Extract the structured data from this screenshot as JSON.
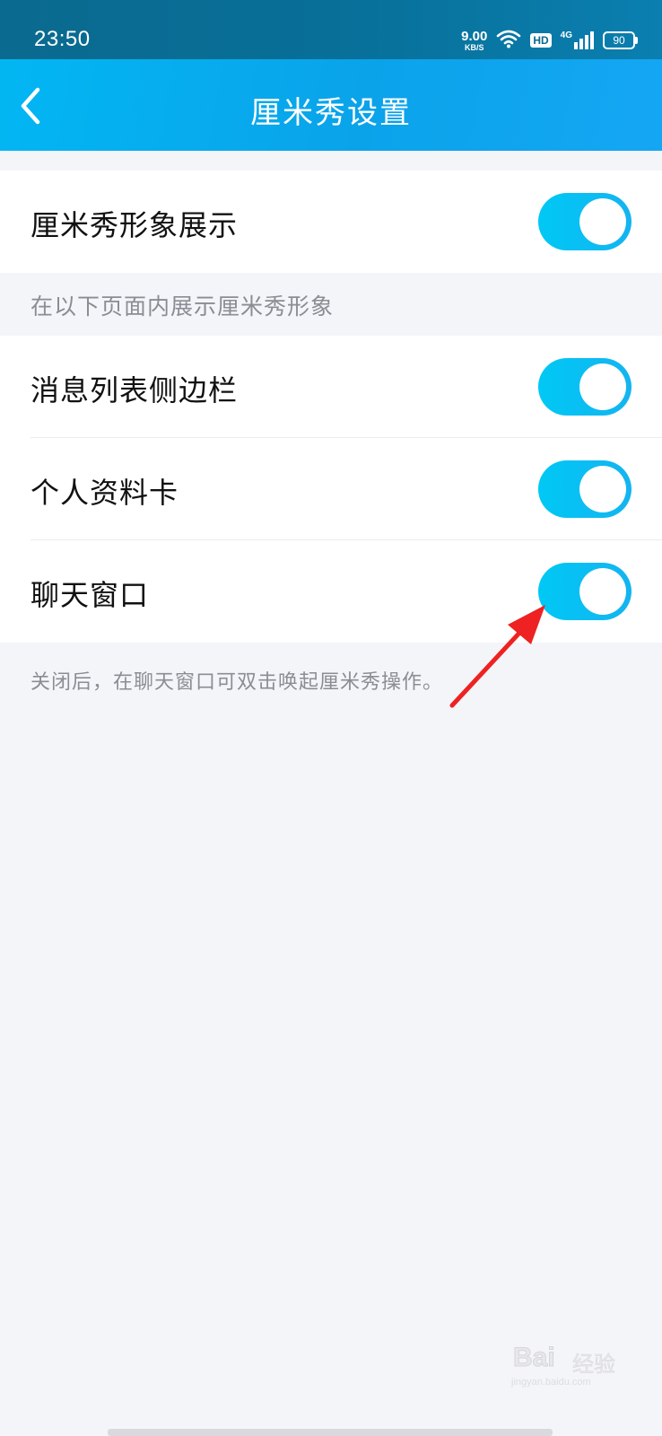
{
  "status_bar": {
    "time": "23:50",
    "net_speed_value": "9.00",
    "net_speed_unit": "KB/S",
    "hd_badge": "HD",
    "network_type": "4G",
    "battery_level": "90",
    "icons": [
      "wifi-icon",
      "signal-icon",
      "battery-icon"
    ]
  },
  "nav": {
    "back_icon": "chevron-left-icon",
    "title": "厘米秀设置"
  },
  "settings": {
    "main_toggle": {
      "label": "厘米秀形象展示",
      "enabled": true
    },
    "section_caption": "在以下页面内展示厘米秀形象",
    "items": [
      {
        "label": "消息列表侧边栏",
        "enabled": true
      },
      {
        "label": "个人资料卡",
        "enabled": true
      },
      {
        "label": "聊天窗口",
        "enabled": true
      }
    ],
    "footer_caption": "关闭后，在聊天窗口可双击唤起厘米秀操作。"
  },
  "annotation": {
    "arrow_color": "#ee2222"
  },
  "watermark": {
    "brand": "Bai",
    "brand_suffix": "经验",
    "url": "jingyan.baidu.com"
  },
  "colors": {
    "accent": "#0aa3ea",
    "toggle_on": "#00c8f5",
    "background": "#f4f5f9"
  }
}
